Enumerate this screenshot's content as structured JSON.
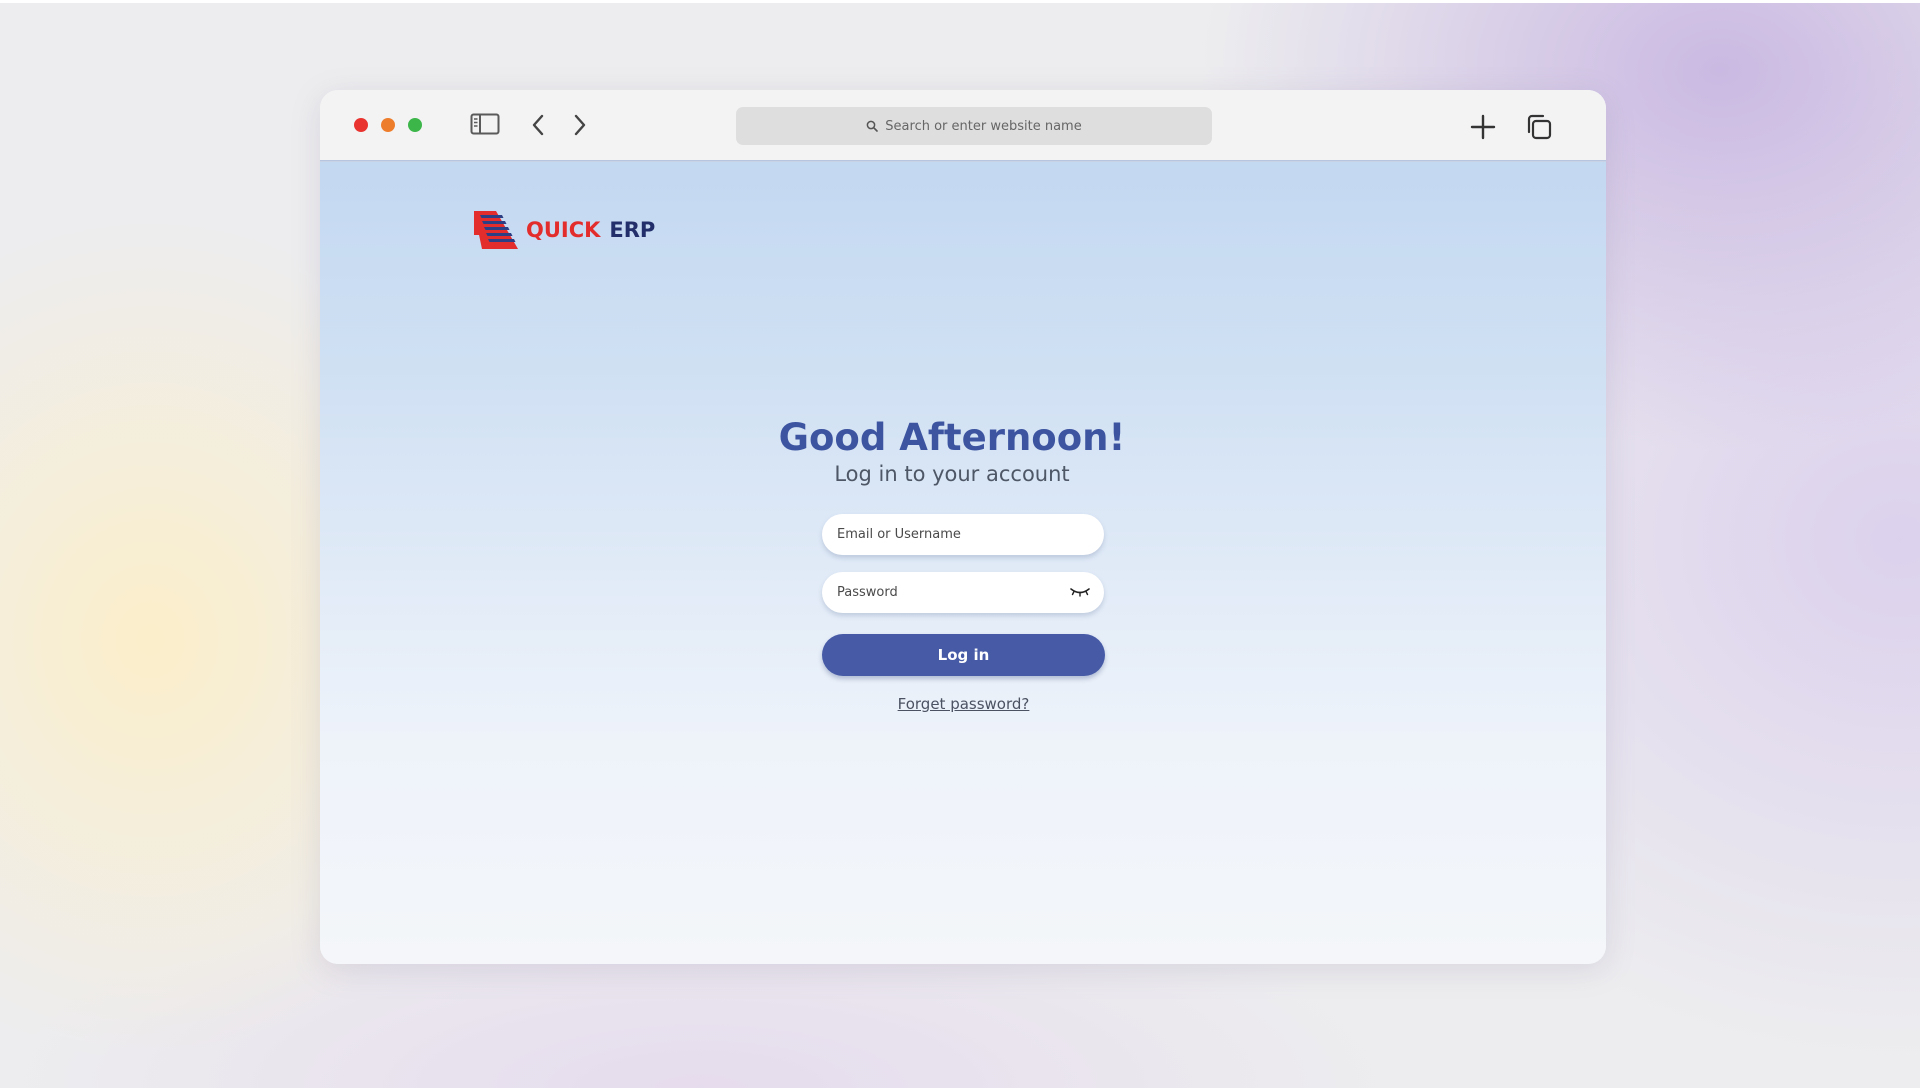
{
  "browser": {
    "window_controls": [
      "close",
      "minimize",
      "maximize"
    ],
    "address_bar": {
      "placeholder": "Search or enter website name"
    },
    "icons": [
      "sidebar-icon",
      "back-icon",
      "forward-icon",
      "search-icon",
      "new-tab-icon",
      "tab-overview-icon"
    ]
  },
  "brand": {
    "name_part1": "QUICK",
    "name_part2": "ERP",
    "colors": {
      "red": "#e32c2c",
      "navy": "#232f6b"
    }
  },
  "login": {
    "greeting": "Good Afternoon!",
    "subtitle": "Log in to your account",
    "email_placeholder": "Email or Username",
    "password_placeholder": "Password",
    "password_toggle_icon": "eye-closed-icon",
    "submit_label": "Log in",
    "forgot_label": "Forget password?",
    "colors": {
      "heading": "#3d55a1",
      "button": "#465aa6"
    }
  }
}
